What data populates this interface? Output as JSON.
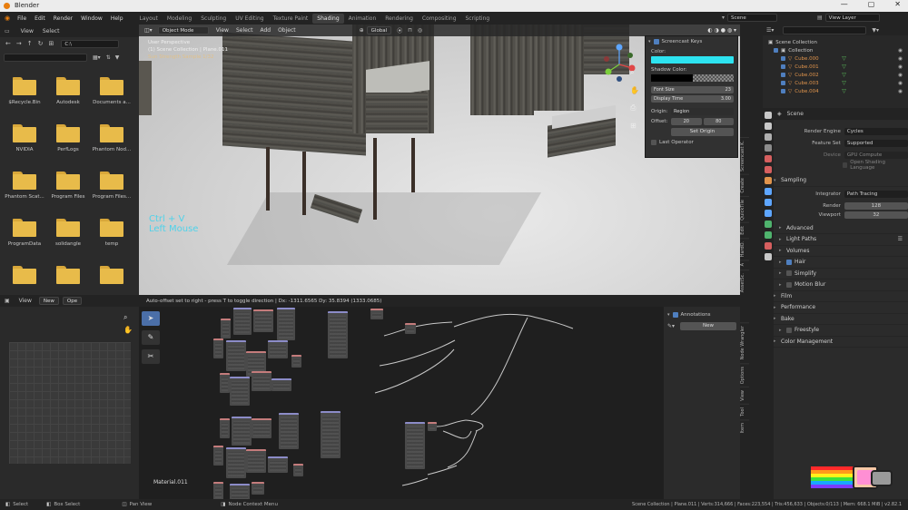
{
  "window": {
    "title": "Blender",
    "controls": [
      "—",
      "▢",
      "✕"
    ]
  },
  "menubar": {
    "menus": [
      "File",
      "Edit",
      "Render",
      "Window",
      "Help"
    ],
    "workspaces": [
      "Layout",
      "Modeling",
      "Sculpting",
      "UV Editing",
      "Texture Paint",
      "Shading",
      "Animation",
      "Rendering",
      "Compositing",
      "Scripting"
    ],
    "active_workspace": "Shading",
    "scene": "Scene",
    "view_layer": "View Layer"
  },
  "filebrowser": {
    "menus": [
      "View",
      "Select"
    ],
    "path": "C:\\",
    "folders": [
      "$Recycle.Bin",
      "Autodesk",
      "Documents a...",
      "NVIDIA",
      "PerfLogs",
      "Phantom Nod...",
      "Phantom Scat...",
      "Program Files",
      "Program Files...",
      "ProgramData",
      "solidangle",
      "temp",
      "",
      "",
      ""
    ]
  },
  "imgeditor": {
    "menus": [
      "View"
    ],
    "new_label": "New",
    "open_label": "Ope"
  },
  "viewport": {
    "mode": "Object Mode",
    "menus": [
      "View",
      "Select",
      "Add",
      "Object"
    ],
    "orientation": "Global",
    "info_lines": [
      "User Perspective",
      "(1) Scene Collection | Plane.011",
      "Sun Strength Sample 1/32"
    ],
    "overlay_keys": [
      "Ctrl + V",
      "Left Mouse"
    ]
  },
  "screencast": {
    "title": "Screencast Keys",
    "color_label": "Color:",
    "color": "#2de3f0",
    "shadow_label": "Shadow Color:",
    "font_size_label": "Font Size",
    "font_size": "23",
    "display_time_label": "Display Time",
    "display_time": "3.00",
    "origin_label": "Origin:",
    "origin": "Region",
    "offset_label": "Offset:",
    "offset_x": "20",
    "offset_y": "80",
    "set_origin_label": "Set Origin",
    "last_operator_label": "Last Operator"
  },
  "viewport_tabs": [
    "Screencast K.",
    "Create",
    "QuickTile",
    "Edit",
    "HardO.",
    "A",
    "AssetSc."
  ],
  "outliner": {
    "root": "Scene Collection",
    "items": [
      {
        "name": "Collection",
        "color": "#c8c8c8"
      },
      {
        "name": "Cube.000",
        "color": "#e0944c"
      },
      {
        "name": "Cube.001",
        "color": "#e0944c"
      },
      {
        "name": "Cube.002",
        "color": "#e0944c"
      },
      {
        "name": "Cube.003",
        "color": "#e0944c"
      },
      {
        "name": "Cube.004",
        "color": "#e0944c"
      }
    ]
  },
  "properties": {
    "context": "Scene",
    "render_engine_label": "Render Engine",
    "render_engine": "Cycles",
    "feature_set_label": "Feature Set",
    "feature_set": "Supported",
    "device_label": "Device",
    "device": "GPU Compute",
    "osl_label": "Open Shading Language",
    "sampling_label": "Sampling",
    "integrator_label": "Integrator",
    "integrator": "Path Tracing",
    "render_label": "Render",
    "render_samples": "128",
    "viewport_label": "Viewport",
    "viewport_samples": "32",
    "advanced_label": "Advanced",
    "sections": [
      {
        "label": "Light Paths",
        "check": false
      },
      {
        "label": "Volumes",
        "check": false
      },
      {
        "label": "Hair",
        "check": true
      },
      {
        "label": "Simplify",
        "check": false
      },
      {
        "label": "Motion Blur",
        "check": false
      },
      {
        "label": "Film",
        "check": false
      },
      {
        "label": "Performance",
        "check": false
      },
      {
        "label": "Bake",
        "check": false
      },
      {
        "label": "Freestyle",
        "check": false
      },
      {
        "label": "Color Management",
        "check": false
      }
    ]
  },
  "nodeeditor": {
    "header_status": "Auto-offset set to right - press T to toggle direction | Dx: -1311.6565  Dy: 35.8394 (1333.0685)",
    "material": "Material.011",
    "annotations_label": "Annotations",
    "new_label": "New",
    "tabs": [
      "Node Wrangler",
      "Options",
      "View",
      "Tool",
      "Item"
    ]
  },
  "statusbar": {
    "items": [
      "Select",
      "Box Select",
      "Pan View",
      "Node Context Menu"
    ],
    "stats": "Scene Collection | Plane.011 | Verts:314,666 | Faces:223,554 | Tris:456,633 | Objects:0/113 | Mem: 668.1 MiB | v2.82.1"
  },
  "colors": {
    "accent": "#4b6fa8",
    "cyan": "#2de3f0",
    "folder": "#e8bb4a"
  }
}
